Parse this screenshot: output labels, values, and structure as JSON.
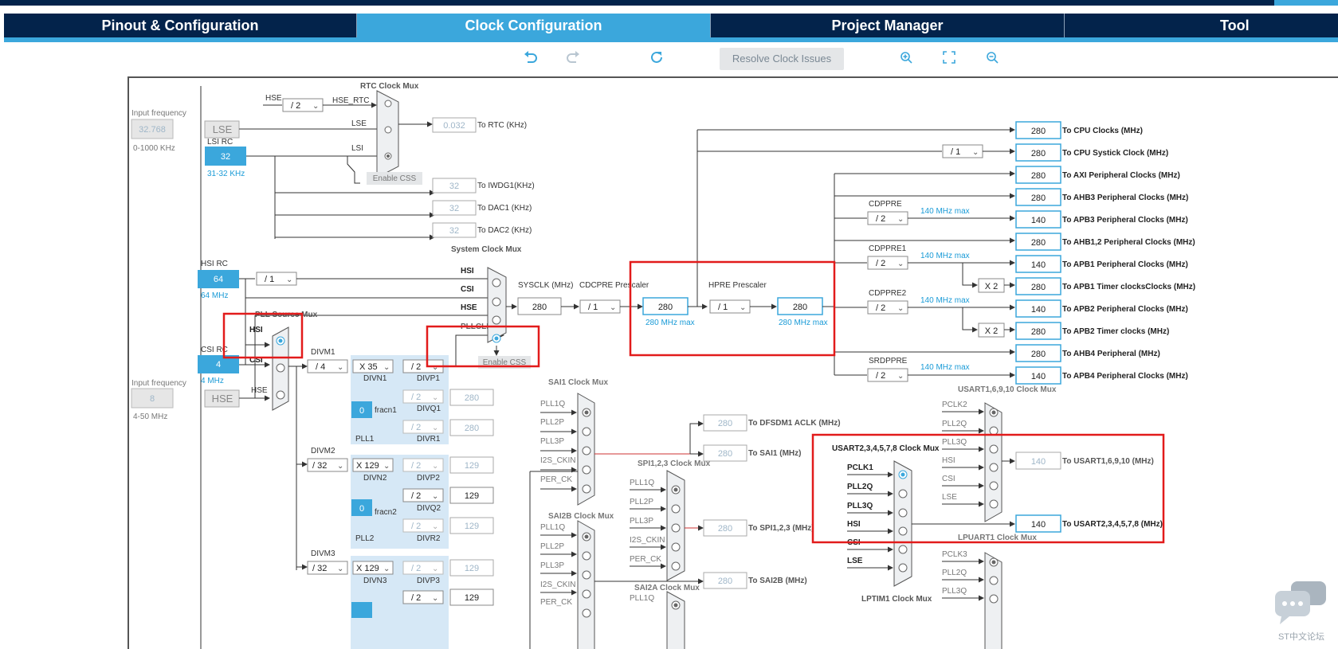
{
  "tabs": [
    {
      "label": "Pinout & Configuration",
      "active": false
    },
    {
      "label": "Clock Configuration",
      "active": true
    },
    {
      "label": "Project Manager",
      "active": false
    },
    {
      "label": "Tool",
      "active": false
    }
  ],
  "toolbar": {
    "resolve_label": "Resolve Clock Issues",
    "icons": [
      "undo-icon",
      "redo-icon",
      "refresh-icon",
      "zoom-in-icon",
      "fit-screen-icon",
      "zoom-out-icon"
    ]
  },
  "colors": {
    "dark_navy": "#03234b",
    "accent": "#3ba7dc",
    "highlight": "#e21b1b",
    "pll_bg": "#d6e8f6"
  },
  "inputs": {
    "lse_freq_label": "Input frequency",
    "lse_freq": "32.768",
    "lse_range": "0-1000 KHz",
    "lse": "LSE",
    "lsi_rc": "LSI RC",
    "lsi_value": "32",
    "lsi_range": "31-32 KHz",
    "hsi_rc": "HSI RC",
    "hsi_value": "64",
    "hsi_mhz": "64 MHz",
    "csi_rc": "CSI RC",
    "csi_value": "4",
    "csi_mhz": "4 MHz",
    "hse_freq_label": "Input frequency",
    "hse_freq": "8",
    "hse": "HSE",
    "hse_range": "4-50 MHz"
  },
  "rtc": {
    "title": "RTC Clock Mux",
    "hse_label": "HSE",
    "hse_div": "/ 2",
    "hse_rtc": "HSE_RTC",
    "lse_label": "LSE",
    "lsi_label": "LSI",
    "enable_css": "Enable CSS",
    "rtc_value": "0.032",
    "rtc_label": "To RTC (KHz)",
    "iwdg_value": "32",
    "iwdg_label": "To IWDG1(KHz)",
    "dac1_value": "32",
    "dac1_label": "To DAC1 (KHz)",
    "dac2_value": "32",
    "dac2_label": "To DAC2 (KHz)"
  },
  "sysmux": {
    "title": "System Clock Mux",
    "hsi": "HSI",
    "csi": "CSI",
    "hse": "HSE",
    "pllclk": "PLLCLK",
    "enable_css": "Enable CSS",
    "hsi_div": "/ 1",
    "sysclk_label": "SYSCLK (MHz)",
    "sysclk_value": "280",
    "cdcpre_label": "CDCPRE Prescaler",
    "cdcpre_div": "/ 1",
    "cpu_value": "280",
    "cpu_max": "280 MHz max",
    "hpre_label": "HPRE Prescaler",
    "hpre_div": "/ 1",
    "hpre_value": "280",
    "hpre_max": "280 MHz max"
  },
  "pll_source": {
    "title": "PLL Source Mux",
    "hsi": "HSI",
    "csi": "CSI",
    "hse": "HSE"
  },
  "pll1": {
    "divm_label": "DIVM1",
    "divm": "/ 4",
    "divn": "X 35",
    "divn_label": "DIVN1",
    "divp": "/ 2",
    "divp_label": "DIVP1",
    "divq": "/ 2",
    "divq_label": "DIVQ1",
    "divq_out": "280",
    "divr": "/ 2",
    "divr_label": "DIVR1",
    "divr_out": "280",
    "frac": "0",
    "frac_label": "fracn1",
    "name": "PLL1"
  },
  "pll2": {
    "divm_label": "DIVM2",
    "divm": "/ 32",
    "divn": "X 129",
    "divn_label": "DIVN2",
    "divp": "/ 2",
    "divp_label": "DIVP2",
    "divp_out": "129",
    "divq": "/ 2",
    "divq_label": "DIVQ2",
    "divq_out": "129",
    "divr": "/ 2",
    "divr_label": "DIVR2",
    "divr_out": "129",
    "frac": "0",
    "frac_label": "fracn2",
    "name": "PLL2"
  },
  "pll3": {
    "divm_label": "DIVM3",
    "divm": "/ 32",
    "divn": "X 129",
    "divn_label": "DIVN3",
    "divp": "/ 2",
    "divp_label": "DIVP3",
    "divp_out": "129",
    "divq": "/ 2",
    "divq_out": "129"
  },
  "outputs": [
    {
      "value": "280",
      "label": "To CPU Clocks (MHz)"
    },
    {
      "value": "280",
      "label": "To CPU Systick Clock (MHz)"
    },
    {
      "value": "280",
      "label": "To AXI Peripheral Clocks (MHz)"
    },
    {
      "value": "280",
      "label": "To AHB3 Peripheral Clocks  (MHz)"
    },
    {
      "value": "140",
      "label": "To APB3 Peripheral Clocks (MHz)"
    },
    {
      "value": "280",
      "label": "To AHB1,2 Peripheral Clocks (MHz)"
    },
    {
      "value": "140",
      "label": "To APB1 Peripheral Clocks (MHz)"
    },
    {
      "value": "280",
      "label": "To APB1 Timer clocksClocks (MHz)"
    },
    {
      "value": "140",
      "label": "To APB2 Peripheral Clocks (MHz)"
    },
    {
      "value": "280",
      "label": "To APB2 Timer clocks (MHz)"
    },
    {
      "value": "280",
      "label": "To AHB4 Peripheral (MHz)"
    },
    {
      "value": "140",
      "label": "To APB4 Peripheral Clocks (MHz)"
    }
  ],
  "prescalers": {
    "systick_div": "/ 1",
    "cdppre": "CDPPRE",
    "cdppre_div": "/ 2",
    "cdppre_max": "140 MHz max",
    "cdppre1": "CDPPRE1",
    "cdppre1_div": "/ 2",
    "cdppre1_max": "140 MHz max",
    "cdppre2": "CDPPRE2",
    "cdppre2_div": "/ 2",
    "cdppre2_max": "140 MHz max",
    "srdppre": "SRDPPRE",
    "srdppre_div": "/ 2",
    "srdppre_max": "140 MHz max",
    "x2": "X 2"
  },
  "sai1": {
    "title": "SAI1 Clock Mux",
    "inputs": [
      "PLL1Q",
      "PLL2P",
      "PLL3P",
      "I2S_CKIN",
      "PER_CK"
    ],
    "dfsdm_value": "280",
    "dfsdm_label": "To DFSDM1 ACLK (MHz)",
    "sai1_value": "280",
    "sai1_label": "To SAI1 (MHz)"
  },
  "spi": {
    "title": "SPI1,2,3 Clock Mux",
    "inputs": [
      "PLL1Q",
      "PLL2P",
      "PLL3P",
      "I2S_CKIN",
      "PER_CK"
    ],
    "value": "280",
    "label": "To SPI1,2,3 (MHz)"
  },
  "sai2b": {
    "title": "SAI2B Clock Mux",
    "inputs": [
      "PLL1Q",
      "PLL2P",
      "PLL3P",
      "I2S_CKIN",
      "PER_CK"
    ],
    "value": "280",
    "label": "To SAI2B (MHz)"
  },
  "sai2a": {
    "title": "SAI2A Clock Mux",
    "inputs": [
      "PLL1Q"
    ]
  },
  "usart16": {
    "title": "USART1,6,9,10 Clock Mux",
    "inputs": [
      "PCLK2",
      "PLL2Q",
      "PLL3Q",
      "HSI",
      "CSI",
      "LSE"
    ],
    "value": "140",
    "label": "To USART1,6,9,10 (MHz)"
  },
  "usart2": {
    "title": "USART2,3,4,5,7,8 Clock Mux",
    "inputs": [
      "PCLK1",
      "PLL2Q",
      "PLL3Q",
      "HSI",
      "CSI",
      "LSE"
    ],
    "value": "140",
    "label": "To USART2,3,4,5,7,8 (MHz)"
  },
  "lpuart": {
    "title": "LPUART1 Clock Mux",
    "inputs": [
      "PCLK3",
      "PLL2Q",
      "PLL3Q"
    ]
  },
  "lptim": {
    "title": "LPTIM1 Clock Mux"
  },
  "watermark": "ST中文论坛"
}
